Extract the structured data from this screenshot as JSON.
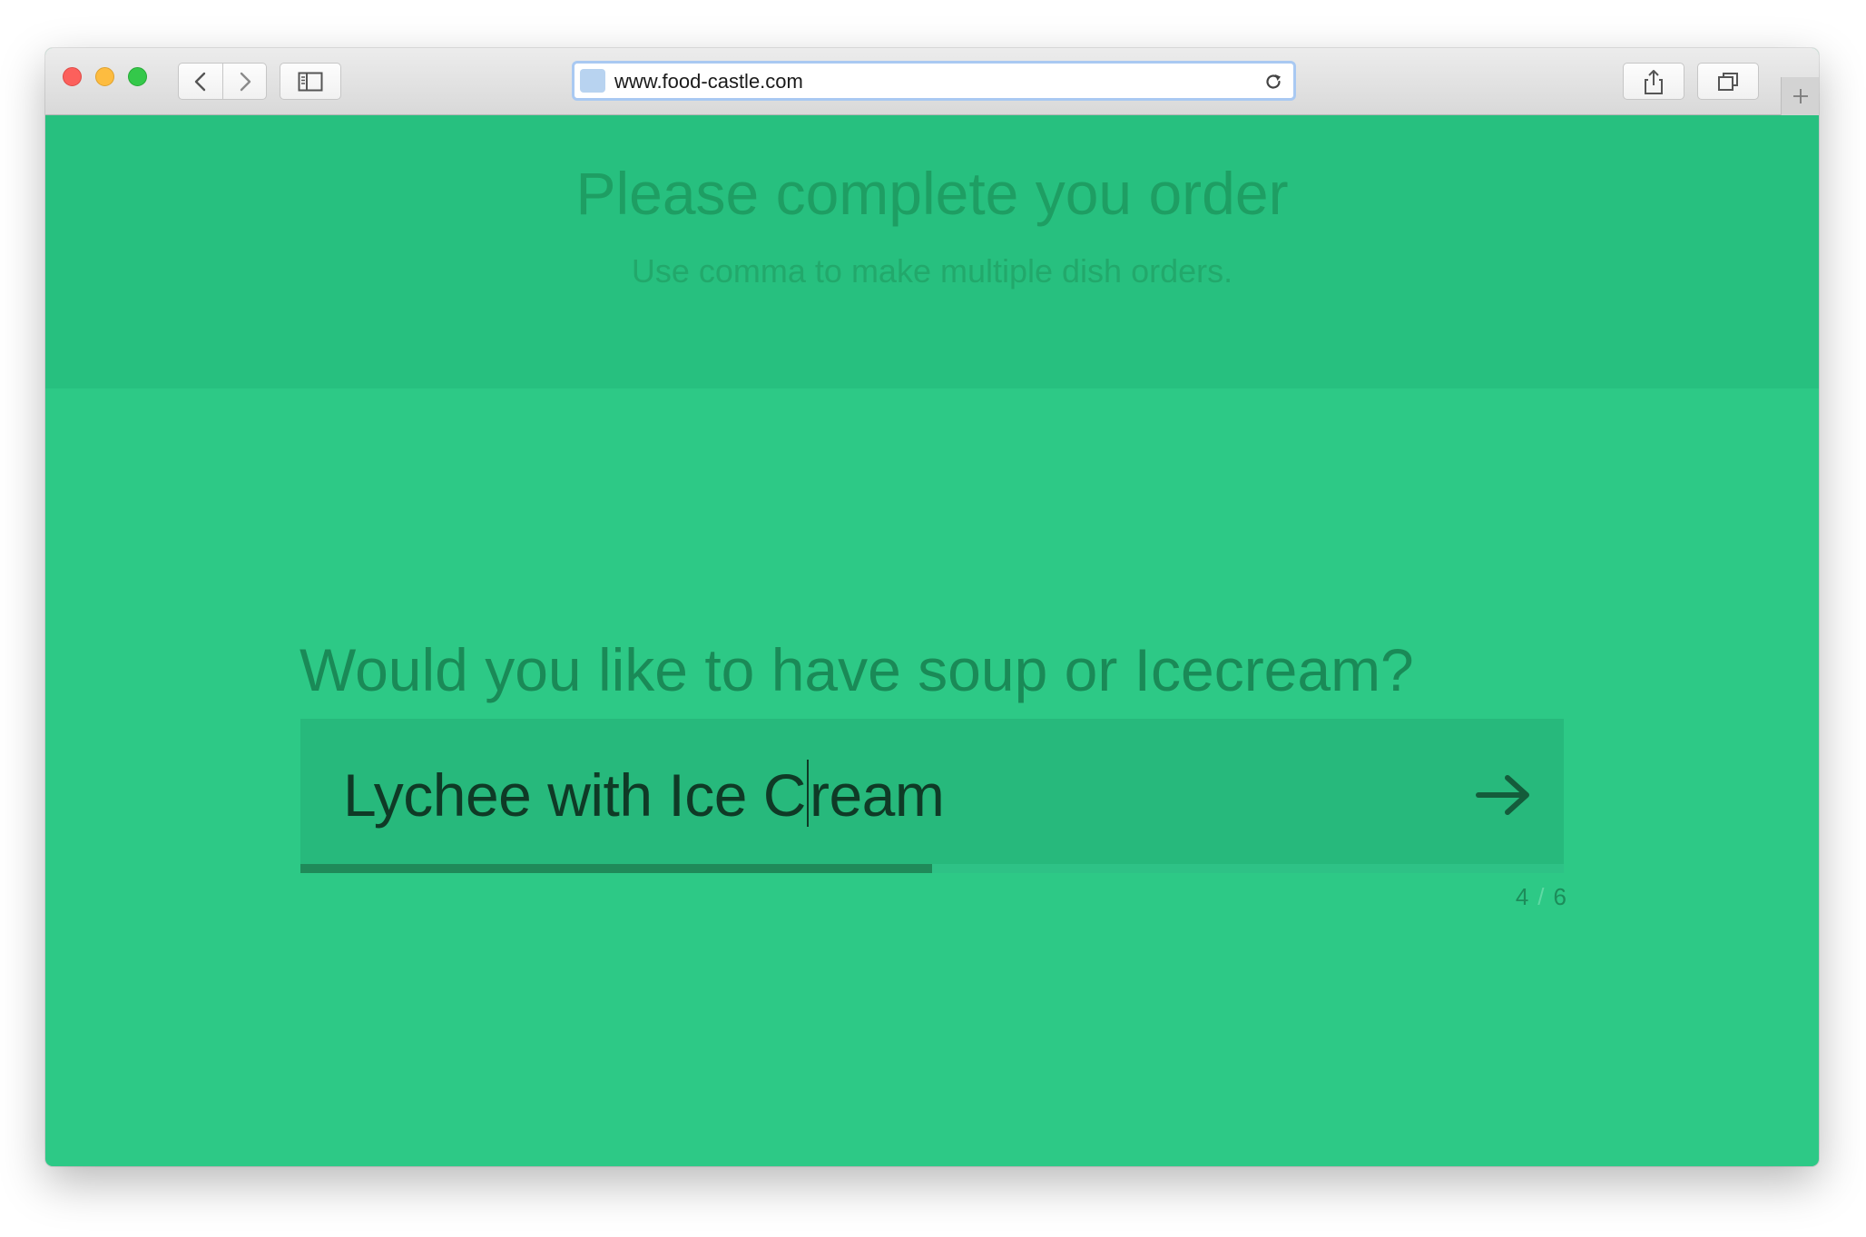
{
  "browser": {
    "url": "www.food-castle.com",
    "icons": [
      "back-icon",
      "forward-icon",
      "sidebar-icon",
      "reload-icon",
      "share-icon",
      "tabs-icon",
      "new-tab-icon"
    ]
  },
  "page": {
    "title": "Please complete you order",
    "subtitle": "Use comma to make multiple dish orders."
  },
  "form": {
    "question": "Would you like to have soup or Icecream?",
    "answer_before_caret": "Lychee with Ice C",
    "answer_after_caret": "ream",
    "progress": 0.5,
    "step_current": "4",
    "step_separator": "/",
    "step_total": "6"
  },
  "colors": {
    "background": "#2dc986",
    "header_band": "#27c07f",
    "input_background": "#27b97c",
    "progress_fill": "#1f8a59"
  }
}
